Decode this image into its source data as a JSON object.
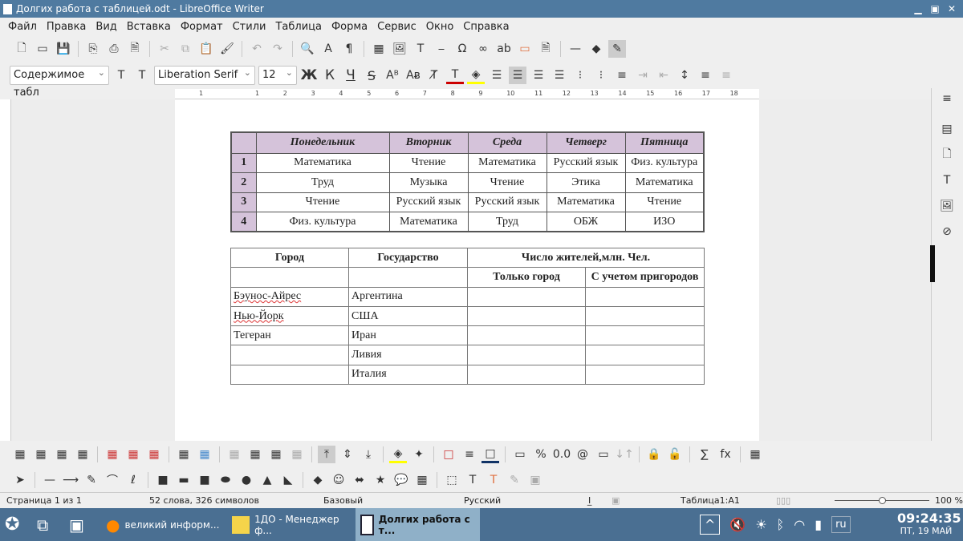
{
  "window": {
    "title": "Долгих работа с таблицей.odt - LibreOffice Writer"
  },
  "menu": [
    "Файл",
    "Правка",
    "Вид",
    "Вставка",
    "Формат",
    "Стили",
    "Таблица",
    "Форма",
    "Сервис",
    "Окно",
    "Справка"
  ],
  "format_bar": {
    "paragraph_style": "Содержимое табл",
    "font_name": "Liberation Serif",
    "font_size": "12",
    "bold": "Ж",
    "italic": "К",
    "underline": "Ч"
  },
  "ruler": [
    "1",
    "1",
    "2",
    "3",
    "4",
    "5",
    "6",
    "7",
    "8",
    "9",
    "10",
    "11",
    "12",
    "13",
    "14",
    "15",
    "16",
    "17",
    "18"
  ],
  "table1": {
    "headers": [
      "",
      "Понедельник",
      "Вторник",
      "Среда",
      "Четверг",
      "Пятница"
    ],
    "rows": [
      [
        "1",
        "Математика",
        "Чтение",
        "Математика",
        "Русский язык",
        "Физ. культура"
      ],
      [
        "2",
        "Труд",
        "Музыка",
        "Чтение",
        "Этика",
        "Математика"
      ],
      [
        "3",
        "Чтение",
        "Русский язык",
        "Русский язык",
        "Математика",
        "Чтение"
      ],
      [
        "4",
        "Физ. культура",
        "Математика",
        "Труд",
        "ОБЖ",
        "ИЗО"
      ]
    ],
    "header_color": "#d5c3da"
  },
  "table2": {
    "headers": [
      "Город",
      "Государство",
      "Число жителей,млн. Чел."
    ],
    "subheaders": [
      "Только город",
      "С учетом пригородов"
    ],
    "rows": [
      [
        "Бэунос-Айрес",
        "Аргентина",
        "",
        ""
      ],
      [
        "Нью-Йорк",
        "США",
        "",
        ""
      ],
      [
        "Тегеран",
        "Иран",
        "",
        ""
      ],
      [
        "",
        "Ливия",
        "",
        ""
      ],
      [
        "",
        "Италия",
        "",
        ""
      ]
    ]
  },
  "status": {
    "page": "Страница 1 из 1",
    "words": "52 слова, 326 символов",
    "style": "Базовый",
    "language": "Русский",
    "cell": "Таблица1:A1",
    "zoom": "100 %",
    "zoom_percent": 100
  },
  "taskbar": {
    "tasks": [
      "великий информ...",
      "1ДО - Менеджер ф...",
      "Долгих работа с т..."
    ],
    "keyboard": "ru",
    "time": "09:24:35",
    "date": "ПТ, 19 МАЙ"
  }
}
